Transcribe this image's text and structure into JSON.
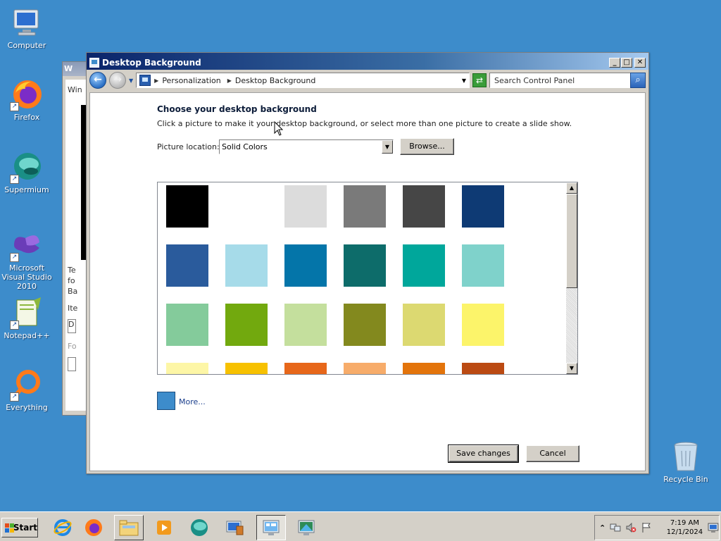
{
  "desktop": {
    "icons": [
      {
        "label": "Computer"
      },
      {
        "label": "Firefox"
      },
      {
        "label": "Supermium"
      },
      {
        "label": "Microsoft Visual Studio 2010"
      },
      {
        "label": "Notepad++"
      },
      {
        "label": "Everything"
      },
      {
        "label": "Recycle Bin"
      }
    ]
  },
  "bg_window": {
    "title": "W",
    "lines": [
      "Win",
      "Te",
      "fo",
      "Ba",
      "Ite",
      "D",
      "Fo"
    ]
  },
  "window": {
    "title": "Desktop Background",
    "controls": {
      "minimize": "_",
      "maximize": "□",
      "close": "✕"
    },
    "breadcrumb": [
      "Personalization",
      "Desktop Background"
    ],
    "search_placeholder": "Search Control Panel",
    "heading": "Choose your desktop background",
    "description": "Click a picture to make it your desktop background, or select more than one picture to create a slide show.",
    "picture_location_label": "Picture location:",
    "picture_location_value": "Solid Colors",
    "browse_label": "Browse...",
    "more_label": "More...",
    "more_color": "#3d8ccb",
    "save_label": "Save changes",
    "cancel_label": "Cancel"
  },
  "swatches": [
    "#000000",
    "#ffffff",
    "#dcdcdc",
    "#7a7a7a",
    "#464646",
    "#0e3a74",
    "#2a5b9c",
    "#a6dbe9",
    "#0475a9",
    "#0d6c6a",
    "#00a79b",
    "#7fd2cb",
    "#84cb9b",
    "#72a90e",
    "#c4df9d",
    "#83891e",
    "#dcd971",
    "#fcf46a",
    "#fdf6a6",
    "#f7c100",
    "#e7671a",
    "#f7ac6a",
    "#e3740b",
    "#bb4a12"
  ],
  "taskbar": {
    "start_label": "Start",
    "items": [
      "internet-explorer",
      "firefox",
      "file-explorer",
      "media-player",
      "supermium",
      "server-manager",
      "control-panel",
      "remote-desktop"
    ],
    "clock_time": "7:19 AM",
    "clock_date": "12/1/2024"
  }
}
